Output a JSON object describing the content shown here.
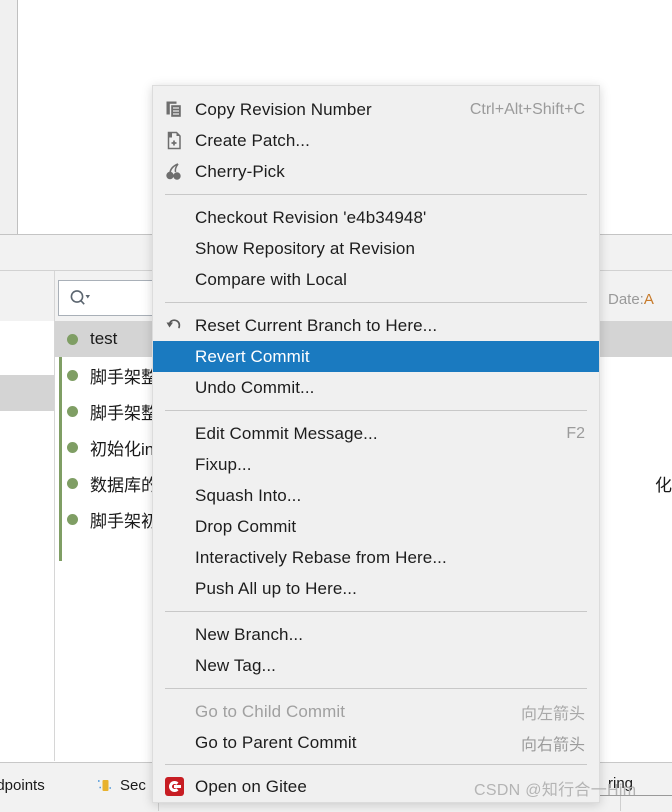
{
  "background": {
    "search": {
      "placeholder": "",
      "value": "",
      "icon": "search-icon"
    },
    "date_header": {
      "label": "Date: ",
      "accent": "A"
    },
    "commits": [
      {
        "message": "test",
        "selected": true
      },
      {
        "message": "脚手架整",
        "selected": false
      },
      {
        "message": "脚手架整",
        "selected": false
      },
      {
        "message": "初始化in",
        "selected": false
      },
      {
        "message": "数据库的",
        "selected": false
      },
      {
        "message": "脚手架初",
        "selected": false
      }
    ],
    "commit_right_fragment": "化",
    "status_bar": {
      "endpoints": "ndpoints",
      "services": "Sec",
      "spring": "ring"
    }
  },
  "context_menu": {
    "groups": [
      {
        "items": [
          {
            "label": "Copy Revision Number",
            "shortcut": "Ctrl+Alt+Shift+C",
            "icon": "copy-icon",
            "state": "normal"
          },
          {
            "label": "Create Patch...",
            "shortcut": "",
            "icon": "patch-icon",
            "state": "normal"
          },
          {
            "label": "Cherry-Pick",
            "shortcut": "",
            "icon": "cherry-pick-icon",
            "state": "normal"
          }
        ]
      },
      {
        "items": [
          {
            "label": "Checkout Revision 'e4b34948'",
            "shortcut": "",
            "icon": "",
            "state": "normal"
          },
          {
            "label": "Show Repository at Revision",
            "shortcut": "",
            "icon": "",
            "state": "normal"
          },
          {
            "label": "Compare with Local",
            "shortcut": "",
            "icon": "",
            "state": "normal"
          }
        ]
      },
      {
        "items": [
          {
            "label": "Reset Current Branch to Here...",
            "shortcut": "",
            "icon": "reset-arrow-icon",
            "state": "normal"
          },
          {
            "label": "Revert Commit",
            "shortcut": "",
            "icon": "",
            "state": "highlighted"
          },
          {
            "label": "Undo Commit...",
            "shortcut": "",
            "icon": "",
            "state": "normal"
          }
        ]
      },
      {
        "items": [
          {
            "label": "Edit Commit Message...",
            "shortcut": "F2",
            "icon": "",
            "state": "normal"
          },
          {
            "label": "Fixup...",
            "shortcut": "",
            "icon": "",
            "state": "normal"
          },
          {
            "label": "Squash Into...",
            "shortcut": "",
            "icon": "",
            "state": "normal"
          },
          {
            "label": "Drop Commit",
            "shortcut": "",
            "icon": "",
            "state": "normal"
          },
          {
            "label": "Interactively Rebase from Here...",
            "shortcut": "",
            "icon": "",
            "state": "normal"
          },
          {
            "label": "Push All up to Here...",
            "shortcut": "",
            "icon": "",
            "state": "normal"
          }
        ]
      },
      {
        "items": [
          {
            "label": "New Branch...",
            "shortcut": "",
            "icon": "",
            "state": "normal"
          },
          {
            "label": "New Tag...",
            "shortcut": "",
            "icon": "",
            "state": "normal"
          }
        ]
      },
      {
        "items": [
          {
            "label": "Go to Child Commit",
            "shortcut": "向左箭头",
            "icon": "",
            "state": "disabled"
          },
          {
            "label": "Go to Parent Commit",
            "shortcut": "向右箭头",
            "icon": "",
            "state": "normal"
          }
        ]
      },
      {
        "items": [
          {
            "label": "Open on Gitee",
            "shortcut": "",
            "icon": "gitee-icon",
            "state": "normal"
          }
        ]
      }
    ]
  },
  "watermark": {
    "text": "CSDN @知行合一Him"
  },
  "colors": {
    "menu_bg": "#f0f0f0",
    "highlight": "#1a7ac0",
    "separator": "#c8c8c8",
    "shortcut_text": "#9b9b9b",
    "disabled_text": "#a0a0a0",
    "commit_node": "#7f9e64",
    "gitee_red": "#c71d23"
  }
}
